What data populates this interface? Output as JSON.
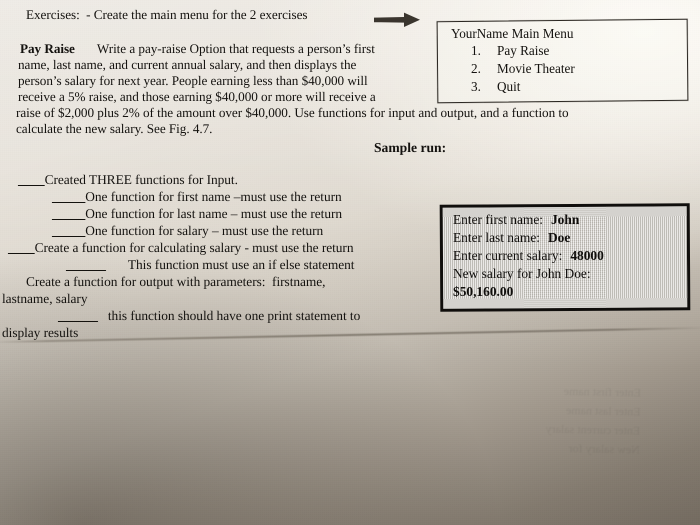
{
  "document": {
    "type": "scanned-worksheet",
    "paper_color": "#e3ded6",
    "ink_color": "#14120f"
  },
  "exercises": {
    "label": "Exercises:",
    "instruction": "- Create the main menu for the 2 exercises",
    "full_line": "Exercises:  - Create the main menu for the 2 exercises",
    "arrow_icon": "right-arrow-icon"
  },
  "pay_raise": {
    "heading": "Pay Raise",
    "lines": [
      "Write a pay-raise Option that requests a person’s first",
      "name, last name, and current annual salary, and then displays the",
      "person’s salary for next year. People earning less than $40,000 will",
      "receive a 5% raise, and those earning $40,000 or more will receive a",
      "raise of $2,000 plus 2% of the amount over $40,000. Use functions for input and output, and a function to",
      "calculate the new salary. See Fig. 4.7."
    ]
  },
  "sample_run_label": "Sample run:",
  "menu_box": {
    "title": "YourName Main Menu",
    "items": [
      {
        "number": "1.",
        "label": "Pay Raise"
      },
      {
        "number": "2.",
        "label": "Movie Theater"
      },
      {
        "number": "3.",
        "label": "Quit"
      }
    ]
  },
  "checklist": {
    "items": [
      {
        "blank": "____",
        "text": "Created THREE functions for Input.",
        "indent": 18
      },
      {
        "blank": "_____",
        "text": "One function for first name –must use the return",
        "indent": 52
      },
      {
        "blank": "_____",
        "text": "One function for last name – must use the return",
        "indent": 52
      },
      {
        "blank": "_____",
        "text": "One function for salary – must use the return",
        "indent": 52
      },
      {
        "blank": "____",
        "text": "Create a function for calculating salary - must use the return",
        "indent": 8
      },
      {
        "blank": "______",
        "text": "This function must use an if else statement",
        "indent": 66
      },
      {
        "blank": "",
        "text": "Create a function for output with parameters:  firstname,",
        "indent": 26
      },
      {
        "blank": "",
        "text": "lastname, salary",
        "indent": 2
      },
      {
        "blank": "______",
        "text": "this function should have one print statement to",
        "indent": 58
      },
      {
        "blank": "",
        "text": "display results",
        "indent": 2
      }
    ]
  },
  "sample_box": {
    "lines": [
      {
        "label": "Enter first name:",
        "value": "John",
        "value_bold": true
      },
      {
        "label": "Enter last name:",
        "value": "Doe",
        "value_bold": true
      },
      {
        "label": "Enter current salary:",
        "value": "48000",
        "value_bold": true
      },
      {
        "label": "New salary for John Doe:",
        "value": "",
        "value_bold": false
      },
      {
        "label": "",
        "value": "$50,160.00",
        "value_bold": true
      }
    ]
  },
  "ghost_text": "Enter first name\nEnter last name\nEnter current salary\nNew salary for"
}
